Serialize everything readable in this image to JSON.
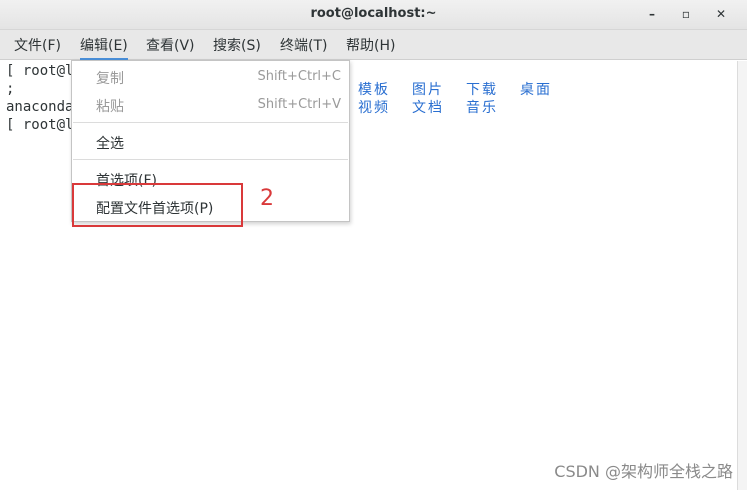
{
  "window": {
    "title": "root@localhost:~",
    "minimize_label": "–",
    "maximize_label": "▫",
    "close_label": "✕"
  },
  "menubar": {
    "items": [
      {
        "label": "文件(F)"
      },
      {
        "label": "编辑(E)"
      },
      {
        "label": "查看(V)"
      },
      {
        "label": "搜索(S)"
      },
      {
        "label": "终端(T)"
      },
      {
        "label": "帮助(H)"
      }
    ]
  },
  "terminal": {
    "lines": [
      "[ root@lo",
      ";",
      "anaconda",
      "[ root@lo"
    ],
    "directories": [
      "模板",
      "图片",
      "下载",
      "桌面",
      "视频",
      "文档",
      "音乐"
    ],
    "directory_color": "#2a6fd1"
  },
  "edit_menu": {
    "items": [
      {
        "label": "复制",
        "accel": "Shift+Ctrl+C",
        "enabled": false
      },
      {
        "label": "粘贴",
        "accel": "Shift+Ctrl+V",
        "enabled": false
      },
      {
        "label": "全选",
        "accel": "",
        "enabled": true
      },
      {
        "label": "首选项(F)",
        "accel": "",
        "enabled": true
      },
      {
        "label": "配置文件首选项(P)",
        "accel": "",
        "enabled": true
      }
    ]
  },
  "annotation": {
    "number": "2",
    "color": "#d9393a"
  },
  "watermark": "CSDN @架构师全栈之路"
}
